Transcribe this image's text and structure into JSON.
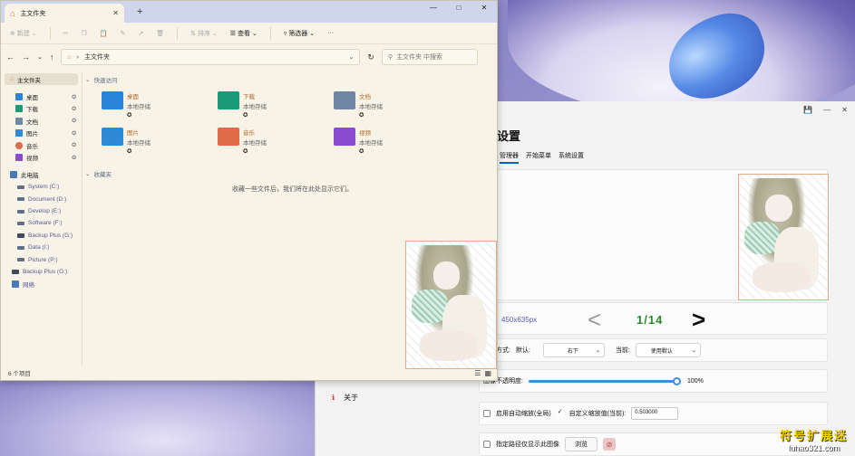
{
  "explorer": {
    "tab_title": "主文件夹",
    "toolbar": {
      "new_label": "新建",
      "sort_label": "排序",
      "view_label": "查看",
      "filter_label": "筛选器",
      "more_label": "···"
    },
    "address": "主文件夹",
    "search_placeholder": "主文件夹 中搜索",
    "sidebar": {
      "home": "主文件夹",
      "pinned": [
        {
          "label": "桌面",
          "color": "#2a84d8"
        },
        {
          "label": "下载",
          "color": "#1a9a7a"
        },
        {
          "label": "文档",
          "color": "#6f86a6"
        },
        {
          "label": "图片",
          "color": "#2c8ad6"
        },
        {
          "label": "音乐",
          "color": "#e06a4a"
        },
        {
          "label": "视频",
          "color": "#8a4ad0"
        }
      ],
      "this_pc": "此电脑",
      "drives": [
        "System (C:)",
        "Document (D:)",
        "Develop (E:)",
        "Software (F:)",
        "Backup Plus (G:)",
        "Data (I:)",
        "Picture (P:)"
      ],
      "backup": "Backup Plus (G:)",
      "network": "网络"
    },
    "quick_access_title": "快速访问",
    "folders": [
      {
        "name": "桌面",
        "sub": "本地存储",
        "color": "#2a84d8"
      },
      {
        "name": "下载",
        "sub": "本地存储",
        "color": "#1a9a7a"
      },
      {
        "name": "文档",
        "sub": "本地存储",
        "color": "#6f86a6"
      },
      {
        "name": "图片",
        "sub": "本地存储",
        "color": "#2c8ad6"
      },
      {
        "name": "音乐",
        "sub": "本地存储",
        "color": "#e06a4a"
      },
      {
        "name": "视频",
        "sub": "本地存储",
        "color": "#8a4ad0"
      }
    ],
    "recent_title": "收藏夹",
    "empty_message": "收藏一些文件后，我们将在此处显示它们。",
    "status": "6 个项目"
  },
  "settings": {
    "title": "设置",
    "tabs": [
      "管理器",
      "开始菜单",
      "系统设置"
    ],
    "image_size": "450x635px",
    "counter": "1/14",
    "prev_symbol": "<",
    "next_symbol": ">",
    "align_label": "对齐方式:",
    "default_label": "默认:",
    "default_value": "右下",
    "current_label": "当前:",
    "current_value": "使用默认",
    "opacity_label": "图像不透明度:",
    "opacity_value": "100%",
    "opacity_fraction": 1.0,
    "auto_zoom_label": "启用自动缩放(全局)",
    "custom_zoom_label": "自定义缩放值(当前):",
    "custom_zoom_value": "0.503000",
    "path_only_label": "指定路径仅显示此图像",
    "browse_label": "浏览",
    "about_label": "关于"
  },
  "watermark": {
    "line1": "符号扩展迷",
    "line2": "fuhao321.com"
  }
}
